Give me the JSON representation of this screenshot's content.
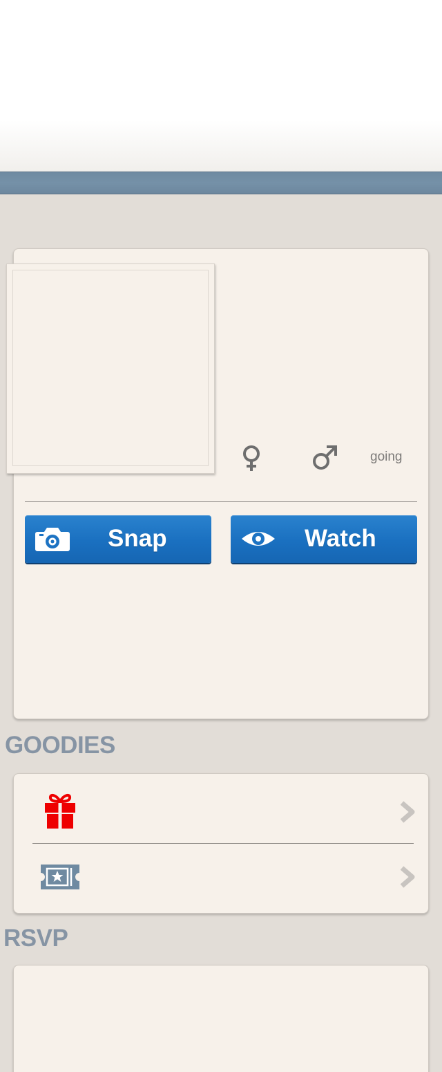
{
  "colors": {
    "nav_bar": "#7590a7",
    "card_bg": "#f7f1ea",
    "page_bg": "#e2ddd7",
    "button_blue": "#1d73c3",
    "section_title": "#8694a4",
    "gift_red": "#ee0000",
    "ticket_slate": "#6f8aa1",
    "chevron_gray": "#c8c4c0"
  },
  "event": {
    "stats": {
      "female_icon": "female-symbol-icon",
      "male_icon": "male-symbol-icon",
      "going_label": "going"
    },
    "actions": {
      "snap_label": "Snap",
      "snap_icon": "camera-icon",
      "watch_label": "Watch",
      "watch_icon": "eye-icon"
    }
  },
  "goodies": {
    "title": "GOODIES",
    "items": [
      {
        "icon": "gift-icon"
      },
      {
        "icon": "ticket-icon"
      }
    ]
  },
  "rsvp": {
    "title": "RSVP"
  }
}
